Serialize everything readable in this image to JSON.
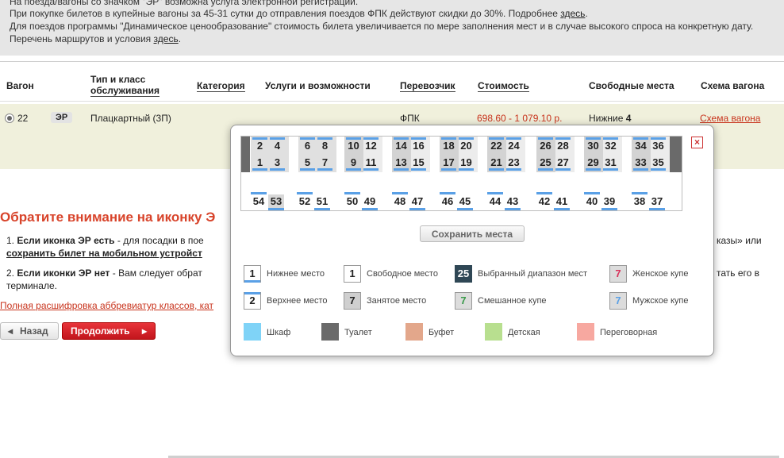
{
  "notice": {
    "line1": "На поезда/вагоны со значком \"ЭР\" возможна услуга электронной регистрации.",
    "line2_pre": "При покупке билетов в купейные вагоны за 45-31 сутки до отправления поездов ФПК действуют скидки до 30%. Подробнее",
    "line2_link": "здесь",
    "line3": "Для поездов программы \"Динамическое ценообразование\" стоимость билета увеличивается по мере заполнения мест и в случае высокого спроса на конкретную дату.",
    "line4_pre": "Перечень маршрутов и условия",
    "line4_link": "здесь"
  },
  "table": {
    "headers": {
      "wagon": "Вагон",
      "type_line1": "Тип и класс",
      "type_line2": "обслуживания",
      "category": "Категория",
      "services": "Услуги и возможности",
      "carrier": "Перевозчик",
      "price": "Стоимость",
      "free": "Свободные места",
      "scheme": "Схема вагона"
    },
    "row": {
      "wagon": "22",
      "badge": "ЭР",
      "type": "Плацкартный (3П)",
      "carrier": "ФПК",
      "price": "698.60 - 1 079.10 р.",
      "free_label": "Нижние",
      "free_count": "4",
      "scheme_link": "Схема вагона"
    }
  },
  "attention": {
    "title": "Обратите внимание на иконку Э",
    "p1_num": "1.",
    "p1_bold": "Если иконка ЭР есть",
    "p1_text": "- для посадки в пое",
    "p1_right": "казы» или",
    "p1_line2": "сохранить билет на мобильном устройст",
    "p2_num": "2.",
    "p2_bold": "Если иконки ЭР нет",
    "p2_text": "- Вам следует обрат",
    "p2_right": "тать его в",
    "p2_line2": "терминале.",
    "abbr_link": "Полная расшифровка аббревиатур классов, кат"
  },
  "buttons": {
    "back": "Назад",
    "continue": "Продолжить"
  },
  "popup": {
    "save": "Сохранить места",
    "bays": [
      {
        "top": [
          "2",
          "4"
        ],
        "bottom": [
          "1",
          "3"
        ],
        "upper_grey": true
      },
      {
        "top": [
          "6",
          "8"
        ],
        "bottom": [
          "5",
          "7"
        ],
        "upper_grey": true
      },
      {
        "top": [
          "10",
          "12"
        ],
        "bottom": [
          "9",
          "11"
        ],
        "upper_grey": false
      },
      {
        "top": [
          "14",
          "16"
        ],
        "bottom": [
          "13",
          "15"
        ],
        "upper_grey": false
      },
      {
        "top": [
          "18",
          "20"
        ],
        "bottom": [
          "17",
          "19"
        ],
        "upper_grey": false
      },
      {
        "top": [
          "22",
          "24"
        ],
        "bottom": [
          "21",
          "23"
        ],
        "upper_grey": false
      },
      {
        "top": [
          "26",
          "28"
        ],
        "bottom": [
          "25",
          "27"
        ],
        "upper_grey": false
      },
      {
        "top": [
          "30",
          "32"
        ],
        "bottom": [
          "29",
          "31"
        ],
        "upper_grey": false
      },
      {
        "top": [
          "34",
          "36"
        ],
        "bottom": [
          "33",
          "35"
        ],
        "upper_grey": false
      }
    ],
    "side": [
      [
        "54",
        "53"
      ],
      [
        "52",
        "51"
      ],
      [
        "50",
        "49"
      ],
      [
        "48",
        "47"
      ],
      [
        "46",
        "45"
      ],
      [
        "44",
        "43"
      ],
      [
        "42",
        "41"
      ],
      [
        "40",
        "39"
      ],
      [
        "38",
        "37"
      ]
    ],
    "legend": {
      "lower": {
        "num": "1",
        "label": "Нижнее место"
      },
      "upper": {
        "num": "2",
        "label": "Верхнее место"
      },
      "free": {
        "num": "1",
        "label": "Свободное место"
      },
      "taken": {
        "num": "7",
        "label": "Занятое место"
      },
      "range": {
        "num": "25",
        "label": "Выбранный диапазон мест"
      },
      "mixed": {
        "num": "7",
        "label": "Смешанное купе"
      },
      "female": {
        "num": "7",
        "label": "Женское купе"
      },
      "male": {
        "num": "7",
        "label": "Мужское купе"
      },
      "wardrobe": "Шкаф",
      "toilet": "Туалет",
      "buffet": "Буфет",
      "kids": "Детская",
      "meeting": "Переговорная"
    },
    "colors": {
      "wardrobe": "#7fd3f7",
      "toilet": "#6a6a6a",
      "buffet": "#e3a78b",
      "kids": "#b8df8f",
      "meeting": "#f7a8a0",
      "female": "#d8335b",
      "male": "#5aa0e6",
      "mixed": "#3a9a4a",
      "range": "#2f4755"
    }
  }
}
